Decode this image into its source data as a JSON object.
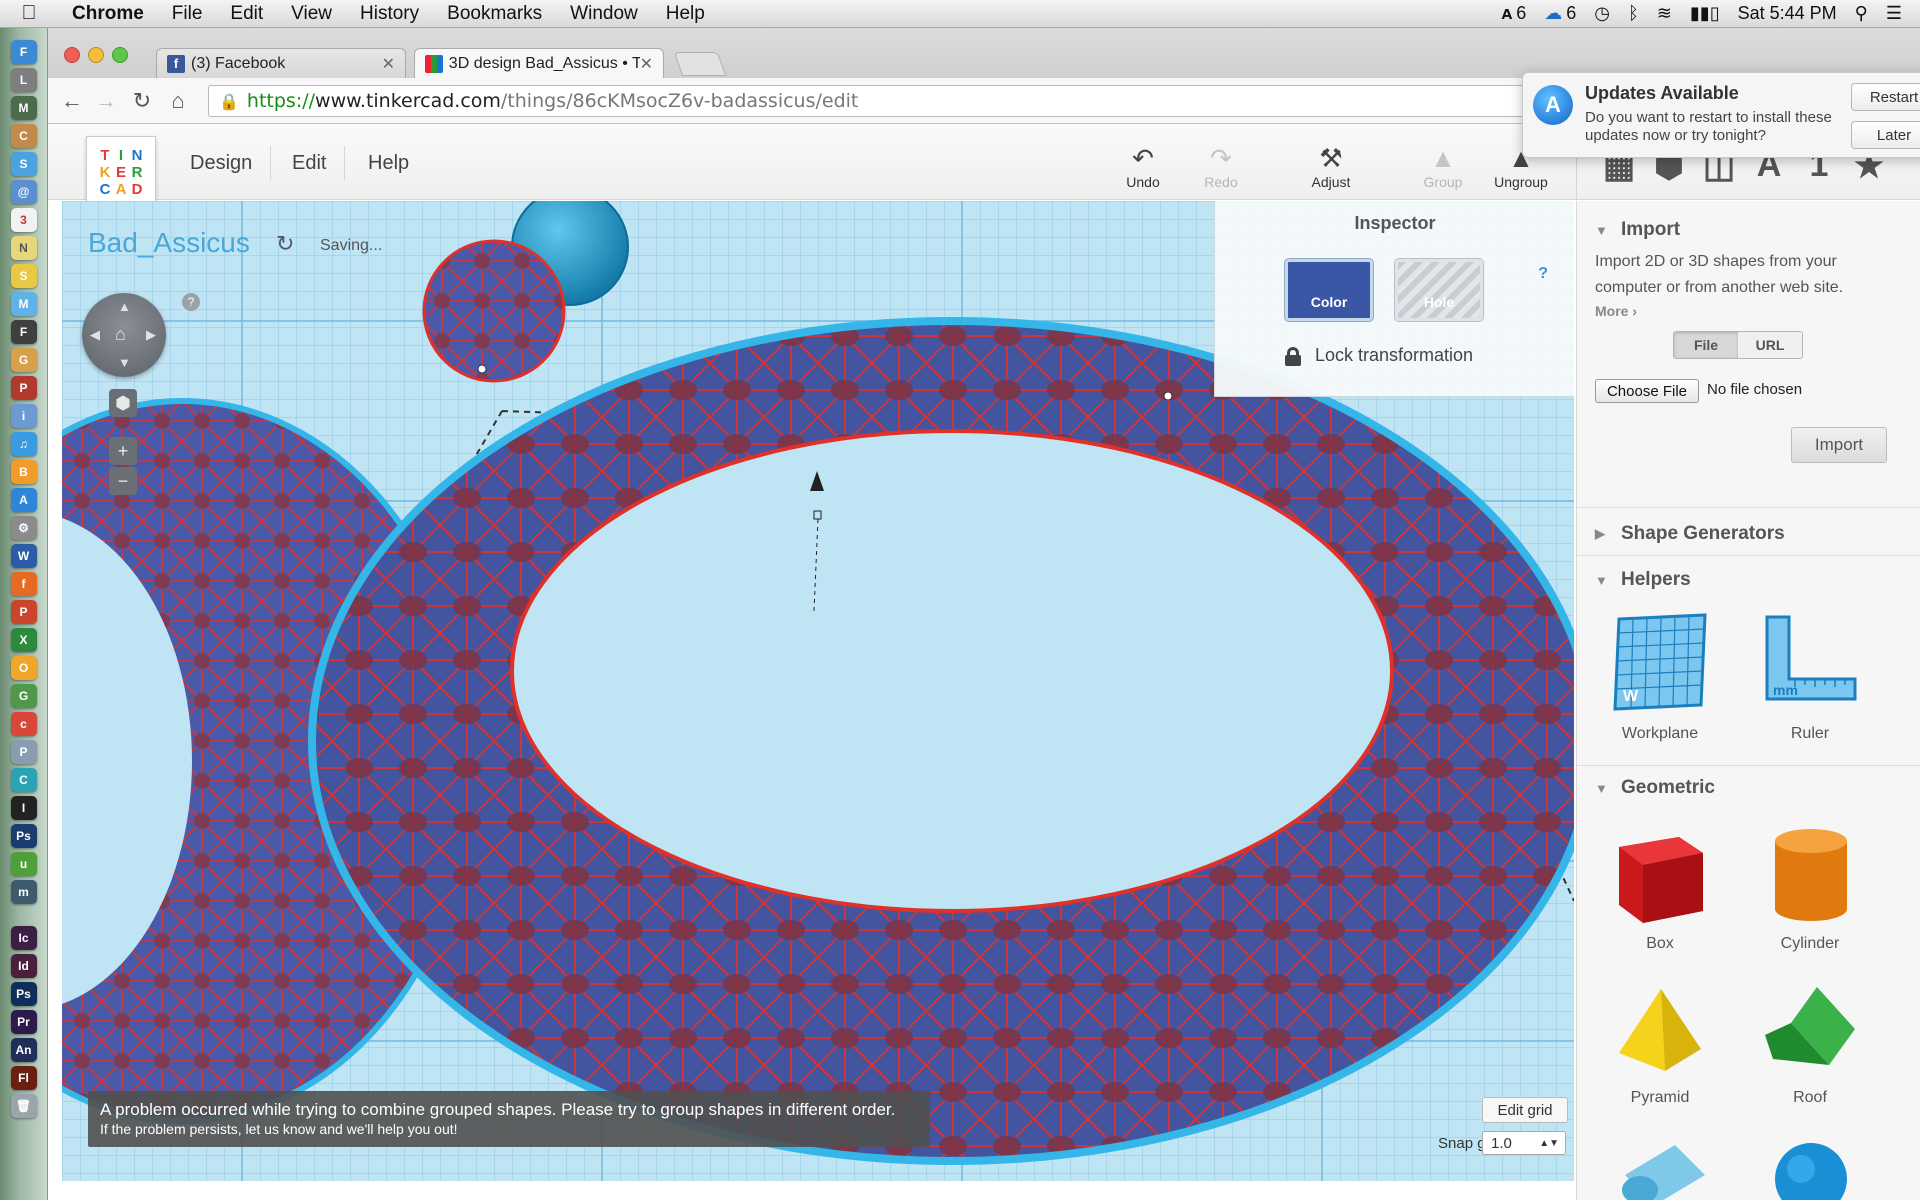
{
  "menubar": {
    "app": "Chrome",
    "items": [
      "File",
      "Edit",
      "View",
      "History",
      "Bookmarks",
      "Window",
      "Help"
    ],
    "adobe_count": "6",
    "cc_count": "6",
    "clock": "Sat 5:44 PM"
  },
  "browser": {
    "tabs": [
      {
        "title": "(3) Facebook"
      },
      {
        "title": "3D design Bad_Assicus • T"
      }
    ],
    "url": {
      "scheme": "https://",
      "host": "www.tinkercad.com",
      "path": "/things/86cKMsocZ6v-badassicus/edit"
    }
  },
  "notification": {
    "title": "Updates Available",
    "body": "Do you want to restart to install these updates now or try tonight?",
    "restart": "Restart",
    "later": "Later"
  },
  "app": {
    "logo_letters": [
      "T",
      "I",
      "N",
      "K",
      "E",
      "R",
      "C",
      "A",
      "D"
    ],
    "menus": [
      "Design",
      "Edit",
      "Help"
    ],
    "tools": {
      "undo": "Undo",
      "redo": "Redo",
      "adjust": "Adjust",
      "group": "Group",
      "ungroup": "Ungroup"
    },
    "side_tabs": {
      "letter": "A",
      "number": "1"
    }
  },
  "viewport": {
    "design_name": "Bad_Assicus",
    "saving": "Saving...",
    "help_q": "?",
    "error_line1": "A problem occurred while trying to combine grouped shapes. Please try to group shapes in different order.",
    "error_line2": "If the problem persists, let us know and we'll help you out!",
    "edit_grid": "Edit grid",
    "snap_label": "Snap grid",
    "snap_value": "1.0"
  },
  "inspector": {
    "title": "Inspector",
    "color_label": "Color",
    "hole_label": "Hole",
    "help": "?",
    "lock_label": "Lock transformation",
    "color_hex": "#3a57a5"
  },
  "sidebar": {
    "import": {
      "title": "Import",
      "desc": "Import 2D or 3D shapes from your computer or from another web site.",
      "more": "More ›",
      "file": "File",
      "url": "URL",
      "choose": "Choose File",
      "nofile": "No file chosen",
      "button": "Import"
    },
    "shape_generators": "Shape Generators",
    "helpers": {
      "title": "Helpers",
      "workplane": "Workplane",
      "ruler": "Ruler"
    },
    "geometric": {
      "title": "Geometric",
      "box": "Box",
      "cylinder": "Cylinder",
      "pyramid": "Pyramid",
      "roof": "Roof"
    }
  }
}
